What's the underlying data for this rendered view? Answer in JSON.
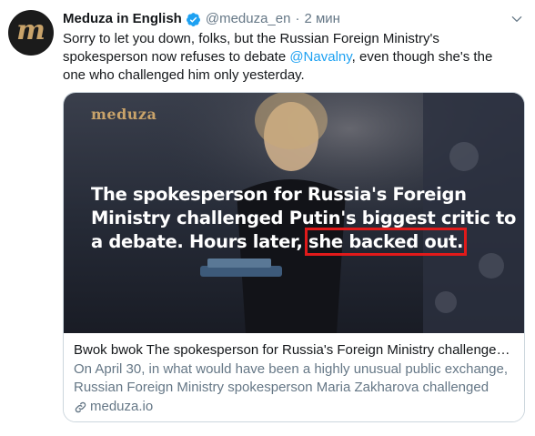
{
  "tweet": {
    "avatar_letter": "m",
    "author_name": "Meduza in English",
    "handle": "@meduza_en",
    "separator": "·",
    "time": "2 мин",
    "text_before": "Sorry to let you down, folks, but the Russian Foreign Ministry's spokesperson now refuses to debate ",
    "mention": "@Navalny",
    "text_after": ", even though she's the one who challenged him only yesterday."
  },
  "card": {
    "image_logo": "meduza",
    "headline_main": "The spokesperson for Russia's Foreign Ministry challenged Putin's biggest critic to a debate. Hours later, ",
    "headline_highlight": "she backed out.",
    "title": "Bwok bwok The spokesperson for Russia's Foreign Ministry challenged Putin's biggest critic",
    "description": "On April 30, in what would have been a highly unusual public exchange, Russian Foreign Ministry spokesperson Maria Zakharova challenged",
    "domain": "meduza.io"
  },
  "colors": {
    "accent": "#1da1f2",
    "secondary_text": "#657786",
    "highlight_box": "#e11a1a",
    "brand_gold": "#c9a36a"
  },
  "icons": [
    "verified-badge-icon",
    "chevron-down-icon",
    "link-icon"
  ]
}
